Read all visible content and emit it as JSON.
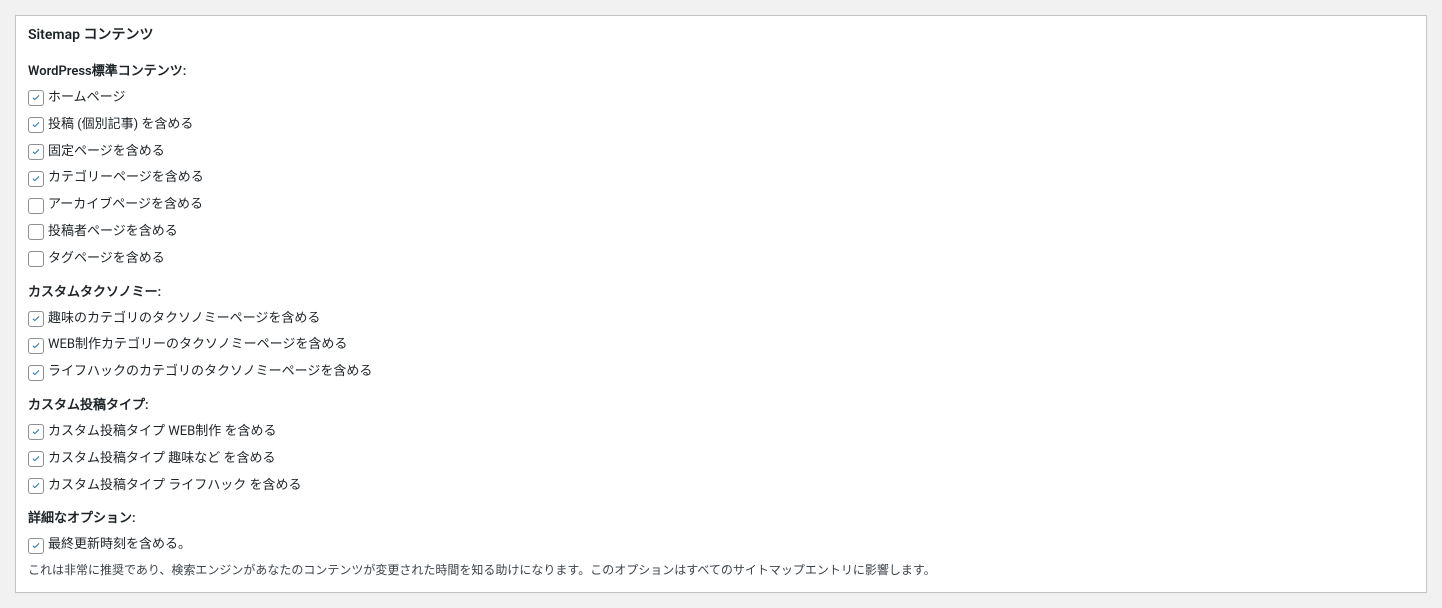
{
  "panel_title": "Sitemap コンテンツ",
  "groups": [
    {
      "heading": "WordPress標準コンテンツ:",
      "items": [
        {
          "label": "ホームページ",
          "checked": true,
          "name": "checkbox-homepage"
        },
        {
          "label": "投稿 (個別記事) を含める",
          "checked": true,
          "name": "checkbox-posts"
        },
        {
          "label": "固定ページを含める",
          "checked": true,
          "name": "checkbox-pages"
        },
        {
          "label": "カテゴリーページを含める",
          "checked": true,
          "name": "checkbox-categories"
        },
        {
          "label": "アーカイブページを含める",
          "checked": false,
          "name": "checkbox-archives"
        },
        {
          "label": "投稿者ページを含める",
          "checked": false,
          "name": "checkbox-authors"
        },
        {
          "label": "タグページを含める",
          "checked": false,
          "name": "checkbox-tags"
        }
      ]
    },
    {
      "heading": "カスタムタクソノミー:",
      "items": [
        {
          "label": "趣味のカテゴリのタクソノミーページを含める",
          "checked": true,
          "name": "checkbox-tax-hobby"
        },
        {
          "label": "WEB制作カテゴリーのタクソノミーページを含める",
          "checked": true,
          "name": "checkbox-tax-web"
        },
        {
          "label": "ライフハックのカテゴリのタクソノミーページを含める",
          "checked": true,
          "name": "checkbox-tax-lifehack"
        }
      ]
    },
    {
      "heading": "カスタム投稿タイプ:",
      "items": [
        {
          "label": "カスタム投稿タイプ WEB制作 を含める",
          "checked": true,
          "name": "checkbox-cpt-web"
        },
        {
          "label": "カスタム投稿タイプ 趣味など を含める",
          "checked": true,
          "name": "checkbox-cpt-hobby"
        },
        {
          "label": "カスタム投稿タイプ ライフハック を含める",
          "checked": true,
          "name": "checkbox-cpt-lifehack"
        }
      ]
    },
    {
      "heading": "詳細なオプション:",
      "items": [
        {
          "label": "最終更新時刻を含める。",
          "checked": true,
          "name": "checkbox-lastmod"
        }
      ],
      "description": "これは非常に推奨であり、検索エンジンがあなたのコンテンツが変更された時間を知る助けになります。このオプションはすべてのサイトマップエントリに影響します。"
    }
  ]
}
